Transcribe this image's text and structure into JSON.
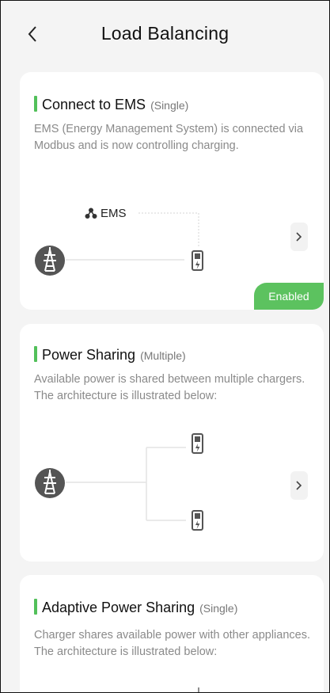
{
  "header": {
    "title": "Load Balancing"
  },
  "cards": [
    {
      "title": "Connect to EMS",
      "mode": "(Single)",
      "description": "EMS (Energy Management System) is connected via Modbus and is now controlling charging.",
      "diagram_label": "EMS",
      "status": "Enabled"
    },
    {
      "title": "Power Sharing",
      "mode": "(Multiple)",
      "description": "Available power is shared between multiple chargers. The architecture is illustrated below:"
    },
    {
      "title": "Adaptive Power Sharing",
      "mode": "(Single)",
      "description": "Charger shares available power with other appliances. The architecture is illustrated below:"
    }
  ],
  "colors": {
    "accent": "#52c05a",
    "enabled_badge": "#5cc25f",
    "card_background": "#ffffff",
    "page_background": "#f4f4f4"
  },
  "icons": [
    "back-arrow-icon",
    "network-icon",
    "power-tower-icon",
    "charger-icon",
    "chevron-right-icon"
  ]
}
